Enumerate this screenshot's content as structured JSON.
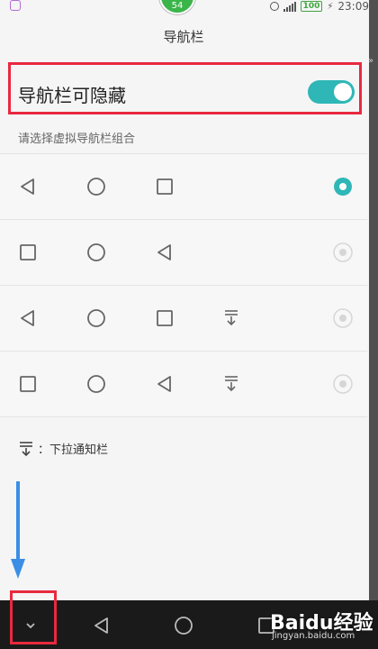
{
  "status_bar": {
    "badge": "54",
    "battery": "100",
    "time": "23:09"
  },
  "page": {
    "title": "导航栏"
  },
  "toggle": {
    "label": "导航栏可隐藏",
    "enabled": true,
    "accent_color": "#2fb7b7"
  },
  "section_label": "请选择虚拟导航栏组合",
  "options": [
    {
      "icons": [
        "back-icon",
        "home-icon",
        "recent-icon"
      ],
      "selected": true
    },
    {
      "icons": [
        "recent-icon",
        "home-icon",
        "back-icon"
      ],
      "selected": false
    },
    {
      "icons": [
        "back-icon",
        "home-icon",
        "recent-icon",
        "notification-pull-icon"
      ],
      "selected": false
    },
    {
      "icons": [
        "recent-icon",
        "home-icon",
        "back-icon",
        "notification-pull-icon"
      ],
      "selected": false
    }
  ],
  "legend": {
    "text": "：下拉通知栏"
  },
  "navbar": {
    "icons": [
      "hide-navbar-icon",
      "back-icon",
      "home-icon",
      "recent-icon"
    ]
  },
  "watermark": {
    "brand": "Baidu经验",
    "url": "jingyan.baidu.com"
  },
  "colors": {
    "highlight": "#e8293f",
    "arrow": "#3a8ee6",
    "navbar_bg": "#1a1a1a"
  }
}
